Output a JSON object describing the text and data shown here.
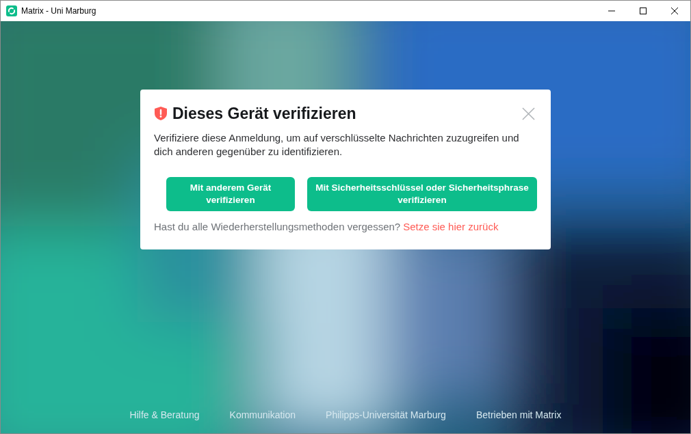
{
  "window": {
    "title": "Matrix - Uni Marburg"
  },
  "dialog": {
    "title": "Dieses Gerät verifizieren",
    "description": "Verifiziere diese Anmeldung, um auf verschlüsselte Nachrichten zuzugreifen und dich anderen gegenüber zu identifizieren.",
    "buttons": [
      {
        "label": "Mit anderem Gerät verifizieren"
      },
      {
        "label": "Mit Sicherheitsschlüssel oder Sicherheitsphrase verifizieren"
      }
    ],
    "reset_prompt": "Hast du alle Wiederherstellungsmethoden vergessen?",
    "reset_link": "Setze sie hier zurück"
  },
  "footer_links": [
    "Hilfe & Beratung",
    "Kommunikation",
    "Philipps-Universität Marburg",
    "Betrieben mit Matrix"
  ]
}
